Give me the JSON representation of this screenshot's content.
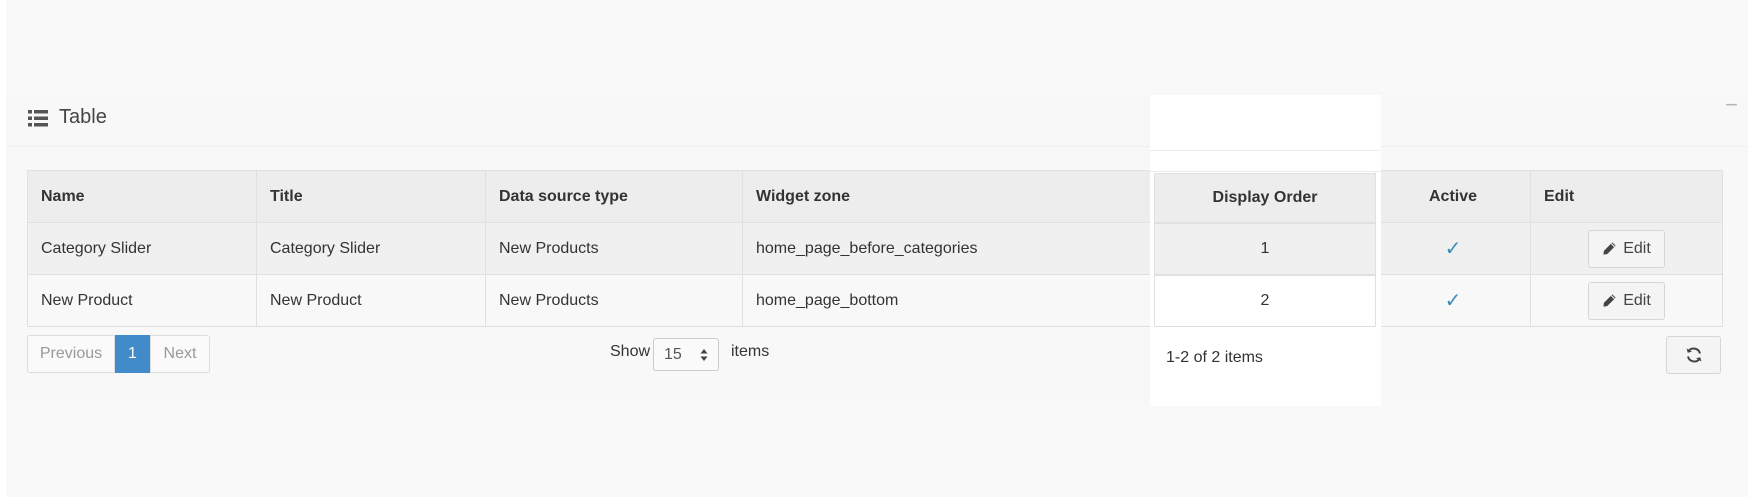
{
  "card": {
    "title": "Table",
    "icon": "list-icon",
    "collapse_label": "−"
  },
  "table": {
    "columns": [
      "Name",
      "Title",
      "Data source type",
      "Widget zone",
      "Display Order",
      "Active",
      "Edit"
    ],
    "rows": [
      {
        "name": "Category Slider",
        "title": "Category Slider",
        "data_source_type": "New Products",
        "widget_zone": "home_page_before_categories",
        "display_order": "1",
        "active": "✓",
        "edit_label": "Edit"
      },
      {
        "name": "New Product",
        "title": "New Product",
        "data_source_type": "New Products",
        "widget_zone": "home_page_bottom",
        "display_order": "2",
        "active": "✓",
        "edit_label": "Edit"
      }
    ]
  },
  "pager": {
    "previous": "Previous",
    "current": "1",
    "next": "Next",
    "show_label": "Show",
    "page_size": "15",
    "items_label": "items",
    "info": "1-2 of 2 items"
  },
  "colors": {
    "accent": "#428bca",
    "check": "#3c8dbc"
  },
  "icons": {
    "header": "list-icon",
    "edit": "pencil-icon",
    "active": "check-icon",
    "refresh": "refresh-icon",
    "select": "sort-arrows-icon"
  }
}
